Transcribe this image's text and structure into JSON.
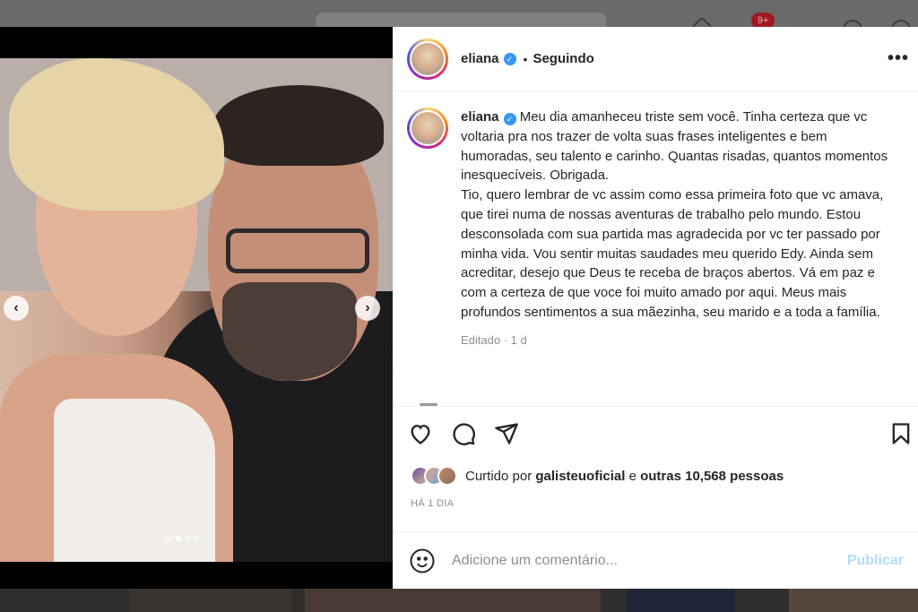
{
  "post": {
    "username": "eliana",
    "verified_glyph": "✓",
    "follow_separator": "•",
    "follow_status": "Seguindo",
    "more_glyph": "•••",
    "caption": "Meu dia amanheceu triste sem você. Tinha certeza que vc voltaria pra nos trazer de volta suas frases inteligentes e bem humoradas, seu talento e carinho. Quantas risadas, quantos momentos inesquecíveis. Obrigada.\nTio, quero lembrar de vc assim como essa primeira foto que vc amava, que tirei numa de nossas aventuras de trabalho pelo mundo. Estou desconsolada com sua partida mas agradecida por vc ter passado por minha vida. Vou sentir muitas saudades meu querido Edy. Ainda sem acreditar, desejo que Deus te receba de braços abertos. Vá em paz e com a certeza de que voce foi muito amado por aqui. Meus mais profundos sentimentos a sua mãezinha, seu marido e a toda a família.",
    "caption_meta": "Editado · 1 d",
    "likes_prefix": "Curtido por",
    "likes_user": "galisteuoficial",
    "likes_joiner": "e",
    "likes_others": "outras 10,568 pessoas",
    "timestamp": "HÁ 1 DIA"
  },
  "carousel": {
    "prev_glyph": "‹",
    "next_glyph": "›",
    "total_slides": 4,
    "active_slide": 2
  },
  "comment": {
    "placeholder": "Adicione um comentário...",
    "publish_label": "Publicar"
  },
  "background": {
    "notification_count": "9+"
  },
  "icons": [
    "heart-icon",
    "comment-icon",
    "share-icon",
    "bookmark-icon",
    "emoji-icon",
    "verified-icon",
    "more-icon"
  ],
  "colors": {
    "verified": "#3897f0",
    "publish": "#b3dbff",
    "muted": "#8e8e8e",
    "text": "#262626"
  }
}
